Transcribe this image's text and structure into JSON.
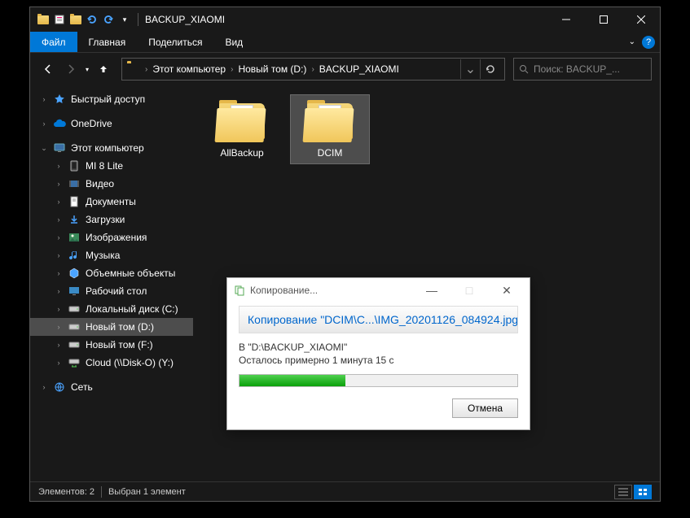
{
  "window": {
    "title": "BACKUP_XIAOMI"
  },
  "ribbon": {
    "file": "Файл",
    "tabs": [
      "Главная",
      "Поделиться",
      "Вид"
    ]
  },
  "breadcrumb": {
    "segments": [
      "Этот компьютер",
      "Новый том (D:)",
      "BACKUP_XIAOMI"
    ]
  },
  "search": {
    "placeholder": "Поиск: BACKUP_..."
  },
  "sidebar": {
    "quick_access": "Быстрый доступ",
    "onedrive": "OneDrive",
    "this_pc": "Этот компьютер",
    "items": [
      "MI 8 Lite",
      "Видео",
      "Документы",
      "Загрузки",
      "Изображения",
      "Музыка",
      "Объемные объекты",
      "Рабочий стол",
      "Локальный диск (C:)",
      "Новый том (D:)",
      "Новый том (F:)",
      "Cloud (\\\\Disk-O) (Y:)"
    ],
    "network": "Сеть"
  },
  "folders": [
    {
      "name": "AllBackup",
      "selected": false
    },
    {
      "name": "DCIM",
      "selected": true
    }
  ],
  "status": {
    "count": "Элементов: 2",
    "selection": "Выбран 1 элемент"
  },
  "dialog": {
    "title": "Копирование...",
    "heading": "Копирование \"DCIM\\C...\\IMG_20201126_084924.jpg\"",
    "destination": "В \"D:\\BACKUP_XIAOMI\"",
    "remaining": "Осталось примерно 1 минута 15 с",
    "progress_percent": 38,
    "cancel": "Отмена"
  }
}
